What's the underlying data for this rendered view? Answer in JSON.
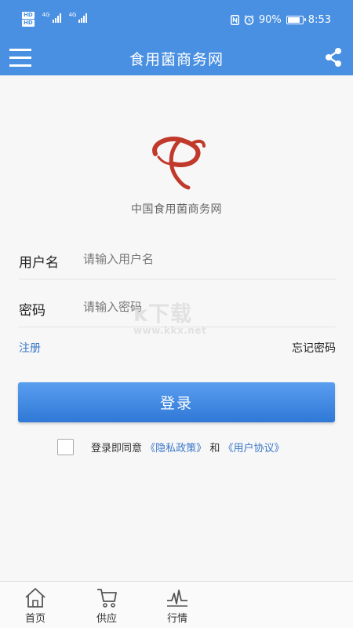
{
  "status_bar": {
    "left_badges": [
      "HD",
      "HD"
    ],
    "network_tags": [
      "4G",
      "4G"
    ],
    "battery_level": 0.9,
    "battery_text": "90%",
    "time": "8:53",
    "icons": [
      "nfc-icon",
      "alarm-icon",
      "battery-icon"
    ]
  },
  "app_bar": {
    "title": "食用菌商务网",
    "left_icon": "menu-icon",
    "right_icon": "share-icon",
    "color": "#4a90e2"
  },
  "brand": {
    "name": "中国食用菌商务网",
    "logo_color": "#c0392b"
  },
  "form": {
    "username": {
      "label": "用户名",
      "placeholder": "请输入用户名",
      "value": ""
    },
    "password": {
      "label": "密码",
      "placeholder": "请输入密码",
      "value": ""
    },
    "register_label": "注册",
    "forgot_label": "忘记密码",
    "login_label": "登录"
  },
  "agreement": {
    "checked": false,
    "prefix": "登录即同意",
    "privacy_link": "《隐私政策》",
    "conjunction": "和",
    "terms_link": "《用户协议》"
  },
  "watermark": {
    "text": "k下载",
    "url": "www.kkx.net"
  },
  "tabs": [
    {
      "label": "首页",
      "icon": "home-icon"
    },
    {
      "label": "供应",
      "icon": "cart-icon"
    },
    {
      "label": "行情",
      "icon": "trend-icon"
    }
  ],
  "colors": {
    "accent": "#4a90e2",
    "link": "#3a78c9"
  }
}
